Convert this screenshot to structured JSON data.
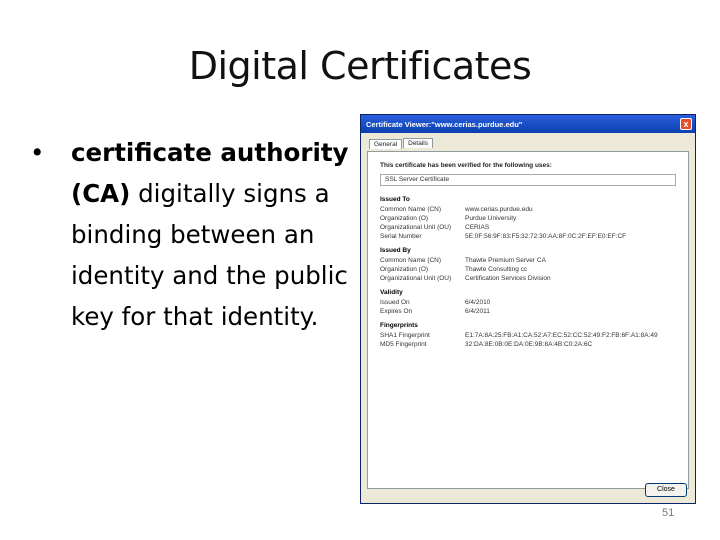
{
  "slide": {
    "title": "Digital Certificates",
    "bullet_bold": "certificate authority (CA)",
    "bullet_rest": " digitally signs a binding between an identity and the public key for that identity.",
    "page_number": "51"
  },
  "dialog": {
    "title": "Certificate Viewer:\"www.cerias.purdue.edu\"",
    "close_glyph": "x",
    "tabs": [
      "General",
      "Details"
    ],
    "verified_text": "This certificate has been verified for the following uses:",
    "uses": "SSL Server Certificate",
    "issued_to": {
      "heading": "Issued To",
      "rows": [
        {
          "label": "Common Name (CN)",
          "value": "www.cerias.purdue.edu"
        },
        {
          "label": "Organization (O)",
          "value": "Purdue University"
        },
        {
          "label": "Organizational Unit (OU)",
          "value": "CERIAS"
        },
        {
          "label": "Serial Number",
          "value": "5E:0F:56:9F:83:F5:32:72:30:AA:8F:0C:2F:EF:E0:EF:CF"
        }
      ]
    },
    "issued_by": {
      "heading": "Issued By",
      "rows": [
        {
          "label": "Common Name (CN)",
          "value": "Thawte Premium Server CA"
        },
        {
          "label": "Organization (O)",
          "value": "Thawte Consulting cc"
        },
        {
          "label": "Organizational Unit (OU)",
          "value": "Certification Services Division"
        }
      ]
    },
    "validity": {
      "heading": "Validity",
      "rows": [
        {
          "label": "Issued On",
          "value": "6/4/2010"
        },
        {
          "label": "Expires On",
          "value": "6/4/2011"
        }
      ]
    },
    "fingerprints": {
      "heading": "Fingerprints",
      "rows": [
        {
          "label": "SHA1 Fingerprint",
          "value": "E1:7A:8A:25:FB:A1:CA:52:A7:EC:52:CC:52:49:F2:FB:6F:A1:8A:49"
        },
        {
          "label": "MD5 Fingerprint",
          "value": "32:DA:8E:0B:0E:DA:0E:9B:8A:4B:C0:2A:6C"
        }
      ]
    },
    "ok_label": "Close"
  }
}
